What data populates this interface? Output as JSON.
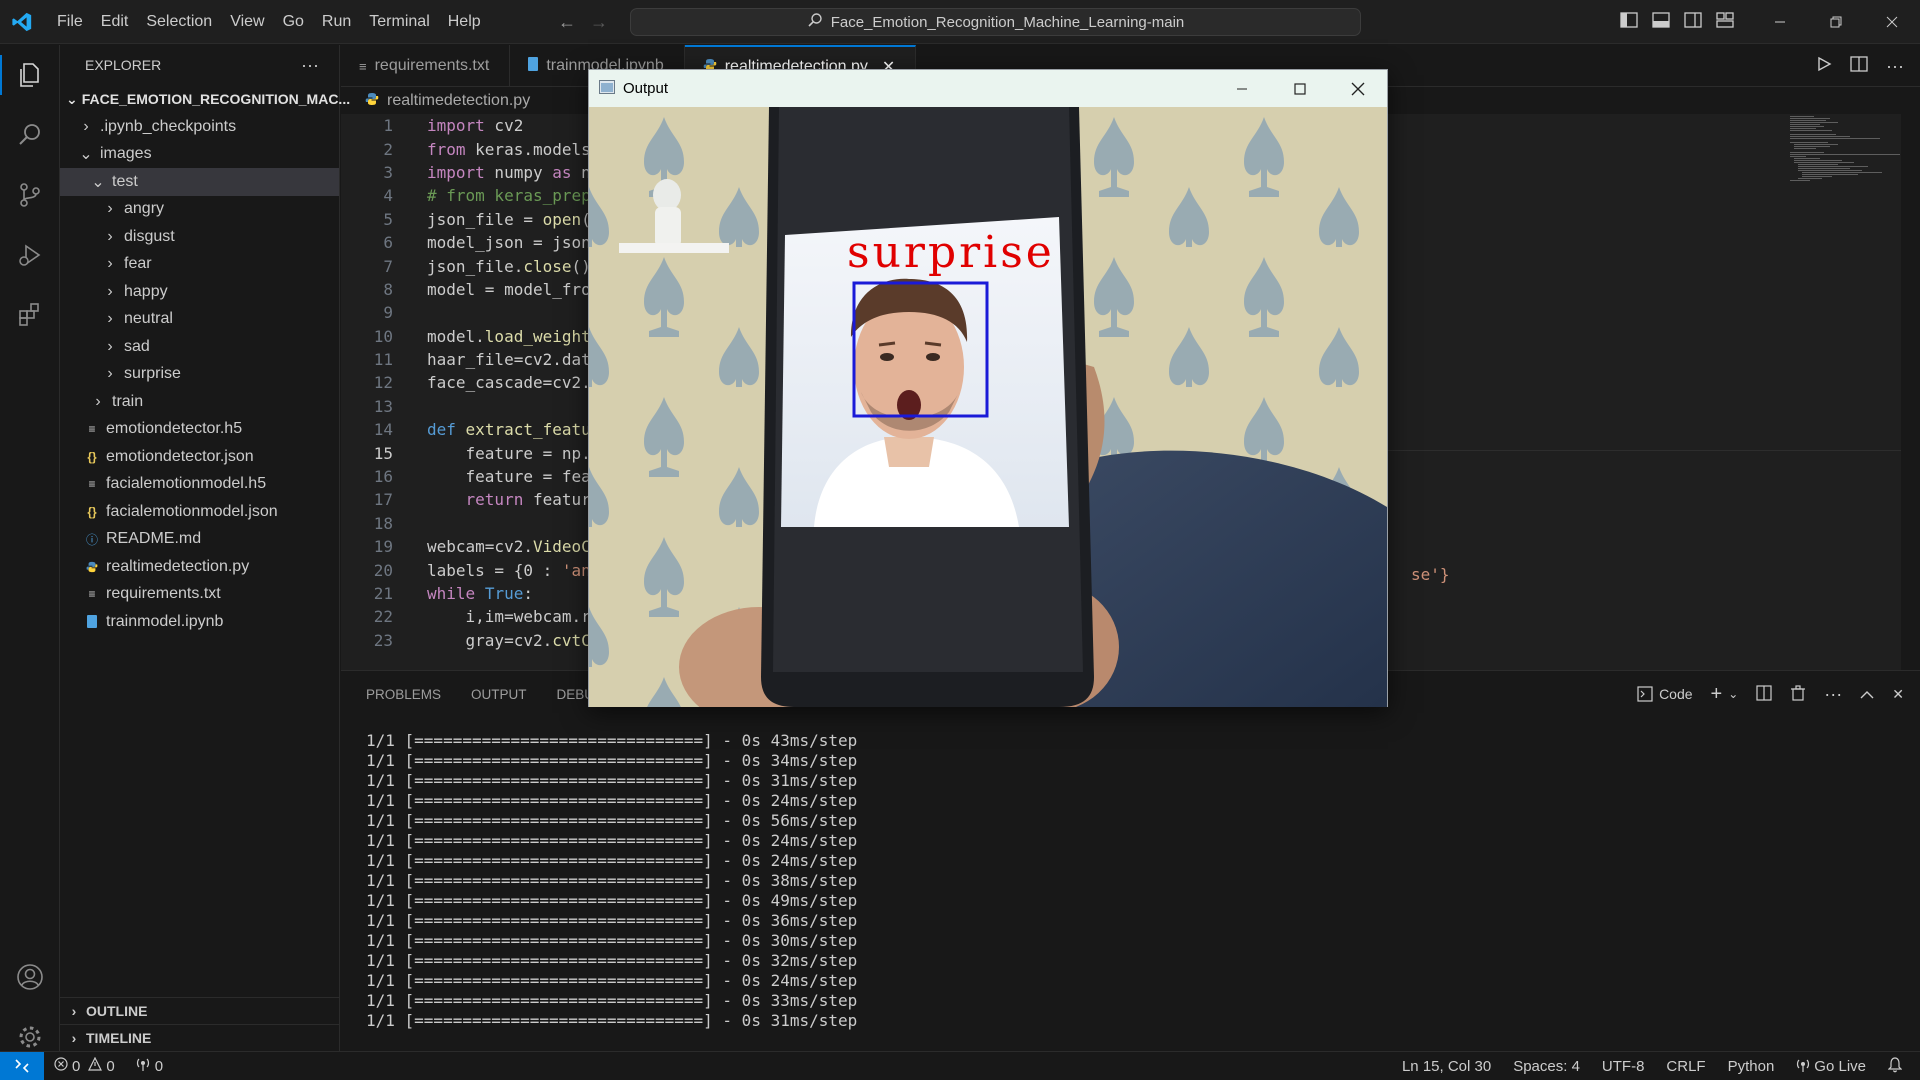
{
  "titlebar": {
    "menu": [
      "File",
      "Edit",
      "Selection",
      "View",
      "Go",
      "Run",
      "Terminal",
      "Help"
    ],
    "search_text": "Face_Emotion_Recognition_Machine_Learning-main"
  },
  "sidebar": {
    "header": "EXPLORER",
    "root": "FACE_EMOTION_RECOGNITION_MAC...",
    "items": [
      {
        "label": ".ipynb_checkpoints",
        "indent": 1,
        "kind": "folder",
        "open": false
      },
      {
        "label": "images",
        "indent": 1,
        "kind": "folder",
        "open": true
      },
      {
        "label": "test",
        "indent": 2,
        "kind": "folder",
        "open": true,
        "selected": true
      },
      {
        "label": "angry",
        "indent": 3,
        "kind": "folder",
        "open": false
      },
      {
        "label": "disgust",
        "indent": 3,
        "kind": "folder",
        "open": false
      },
      {
        "label": "fear",
        "indent": 3,
        "kind": "folder",
        "open": false
      },
      {
        "label": "happy",
        "indent": 3,
        "kind": "folder",
        "open": false
      },
      {
        "label": "neutral",
        "indent": 3,
        "kind": "folder",
        "open": false
      },
      {
        "label": "sad",
        "indent": 3,
        "kind": "folder",
        "open": false
      },
      {
        "label": "surprise",
        "indent": 3,
        "kind": "folder",
        "open": false
      },
      {
        "label": "train",
        "indent": 2,
        "kind": "folder",
        "open": false
      },
      {
        "label": "emotiondetector.h5",
        "indent": 1,
        "kind": "file-lines"
      },
      {
        "label": "emotiondetector.json",
        "indent": 1,
        "kind": "file-json"
      },
      {
        "label": "facialemotionmodel.h5",
        "indent": 1,
        "kind": "file-lines"
      },
      {
        "label": "facialemotionmodel.json",
        "indent": 1,
        "kind": "file-json"
      },
      {
        "label": "README.md",
        "indent": 1,
        "kind": "file-info"
      },
      {
        "label": "realtimedetection.py",
        "indent": 1,
        "kind": "file-python"
      },
      {
        "label": "requirements.txt",
        "indent": 1,
        "kind": "file-lines"
      },
      {
        "label": "trainmodel.ipynb",
        "indent": 1,
        "kind": "file-notebook"
      }
    ],
    "outline": "OUTLINE",
    "timeline": "TIMELINE"
  },
  "tabs": [
    {
      "label": "requirements.txt",
      "active": false
    },
    {
      "label": "trainmodel.ipynb",
      "active": false
    },
    {
      "label": "realtimedetection.py",
      "active": true
    }
  ],
  "breadcrumb": "realtimedetection.py",
  "code_lines": [
    {
      "n": "1",
      "html": "<span class='kw'>import</span> cv2"
    },
    {
      "n": "2",
      "html": "<span class='kw'>from</span> keras.models"
    },
    {
      "n": "3",
      "html": "<span class='kw'>import</span> numpy <span class='kw'>as</span> n"
    },
    {
      "n": "4",
      "html": "<span class='cm'># from keras_prep</span>"
    },
    {
      "n": "5",
      "html": "json_file = <span class='fn'>open</span>("
    },
    {
      "n": "6",
      "html": "model_json = json"
    },
    {
      "n": "7",
      "html": "json_file.<span class='fn'>close</span>()"
    },
    {
      "n": "8",
      "html": "model = model_fro"
    },
    {
      "n": "9",
      "html": ""
    },
    {
      "n": "10",
      "html": "model.<span class='fn'>load_weight</span>"
    },
    {
      "n": "11",
      "html": "haar_file=cv2.dat"
    },
    {
      "n": "12",
      "html": "face_cascade=cv2."
    },
    {
      "n": "13",
      "html": ""
    },
    {
      "n": "14",
      "html": "<span class='kb'>def</span> <span class='fn'>extract_featu</span>"
    },
    {
      "n": "15",
      "html": "    feature = np.",
      "current": true
    },
    {
      "n": "16",
      "html": "    feature = fea"
    },
    {
      "n": "17",
      "html": "    <span class='kw'>return</span> featur"
    },
    {
      "n": "18",
      "html": ""
    },
    {
      "n": "19",
      "html": "webcam=cv2.<span class='fn'>VideoC</span>"
    },
    {
      "n": "20",
      "html": "labels = {0 : <span class='str'>'an</span>"
    },
    {
      "n": "21",
      "html": "<span class='kw'>while</span> <span class='kb'>True</span>:"
    },
    {
      "n": "22",
      "html": "    i,im=webcam.r"
    },
    {
      "n": "23",
      "html": "    gray=cv2.<span class='fn'>cvtC</span>"
    }
  ],
  "code_fragment_right": "se'}",
  "panel": {
    "tabs": [
      "PROBLEMS",
      "OUTPUT",
      "DEBUG CONSOLE"
    ],
    "terminal_profile": "Code",
    "lines": [
      "1/1 [==============================] - 0s 43ms/step",
      "1/1 [==============================] - 0s 34ms/step",
      "1/1 [==============================] - 0s 31ms/step",
      "1/1 [==============================] - 0s 24ms/step",
      "1/1 [==============================] - 0s 56ms/step",
      "1/1 [==============================] - 0s 24ms/step",
      "1/1 [==============================] - 0s 24ms/step",
      "1/1 [==============================] - 0s 38ms/step",
      "1/1 [==============================] - 0s 49ms/step",
      "1/1 [==============================] - 0s 36ms/step",
      "1/1 [==============================] - 0s 30ms/step",
      "1/1 [==============================] - 0s 32ms/step",
      "1/1 [==============================] - 0s 24ms/step",
      "1/1 [==============================] - 0s 33ms/step",
      "1/1 [==============================] - 0s 31ms/step"
    ]
  },
  "statusbar": {
    "errors": "0",
    "warnings": "0",
    "ports": "0",
    "position": "Ln 15, Col 30",
    "spaces": "Spaces: 4",
    "encoding": "UTF-8",
    "eol": "CRLF",
    "language": "Python",
    "golive": "Go Live"
  },
  "output_window": {
    "title": "Output",
    "detected_label": "surprise"
  },
  "colors": {
    "accent": "#0078d4",
    "detection_box": "#1a1ad8",
    "detection_text": "#e00000"
  }
}
